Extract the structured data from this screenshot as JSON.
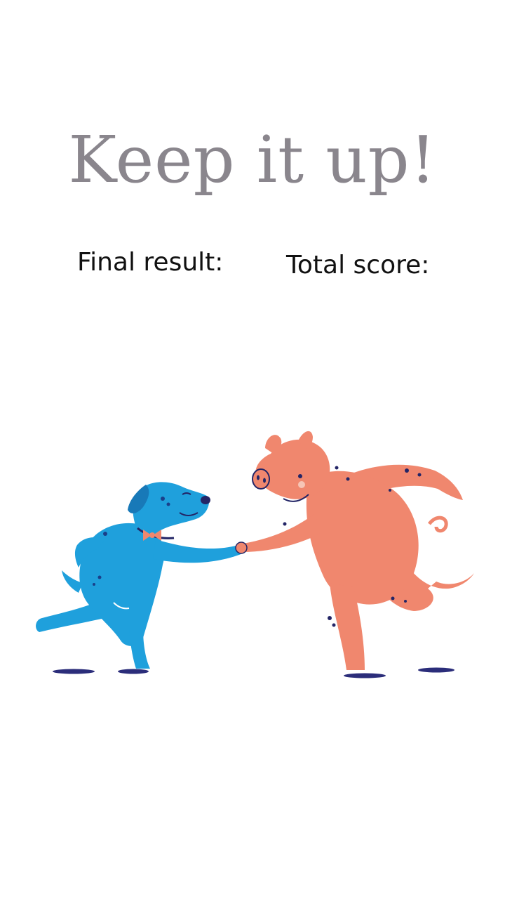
{
  "results_screen": {
    "headline": "Keep it up!",
    "final_result_label": "Final result:",
    "total_score_label": "Total score:"
  },
  "colors": {
    "headline": "#8a868d",
    "dog": "#1fa0dc",
    "pig": "#f0876e",
    "shadow": "#2b2d7a"
  },
  "icons": [
    "dog-illustration",
    "pig-illustration"
  ]
}
